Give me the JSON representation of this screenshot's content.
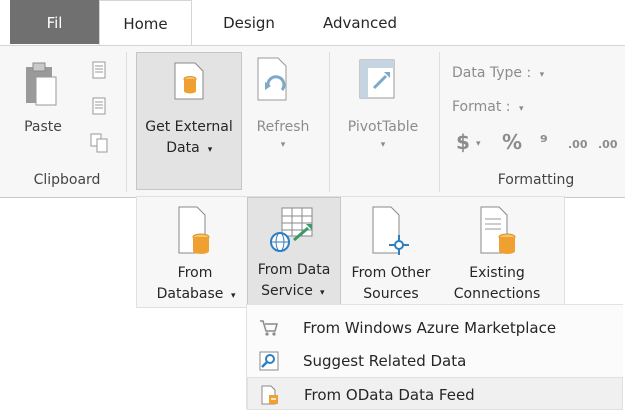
{
  "tabs": {
    "file": "Fil",
    "home": "Home",
    "design": "Design",
    "advanced": "Advanced"
  },
  "clipboard": {
    "paste": "Paste",
    "group_label": "Clipboard"
  },
  "get_data": {
    "line1": "Get External",
    "line2": "Data",
    "arrow": "▾"
  },
  "refresh": {
    "label": "Refresh",
    "arrow": "▾"
  },
  "pivot": {
    "label": "PivotTable",
    "arrow": "▾"
  },
  "formatting": {
    "data_type": "Data Type :",
    "format": "Format :",
    "currency": "$",
    "percent": "%",
    "comma": "⁹",
    "inc_decimal": ".00",
    "dec_decimal": ".00",
    "dd": "▾",
    "group_label": "Formatting"
  },
  "submenu": {
    "from_database": {
      "line1": "From",
      "line2": "Database",
      "arrow": "▾"
    },
    "from_data_service": {
      "line1": "From Data",
      "line2": "Service",
      "arrow": "▾"
    },
    "from_other": {
      "line1": "From Other",
      "line2": "Sources"
    },
    "existing": {
      "line1": "Existing",
      "line2": "Connections"
    }
  },
  "menu": {
    "items": [
      {
        "label": "From Windows Azure Marketplace"
      },
      {
        "label": "Suggest Related Data"
      },
      {
        "label": "From OData Data Feed"
      }
    ]
  },
  "colors": {
    "file_tab": "#707070",
    "accent_orange": "#f0a030",
    "accent_blue": "#2f7fc0"
  }
}
